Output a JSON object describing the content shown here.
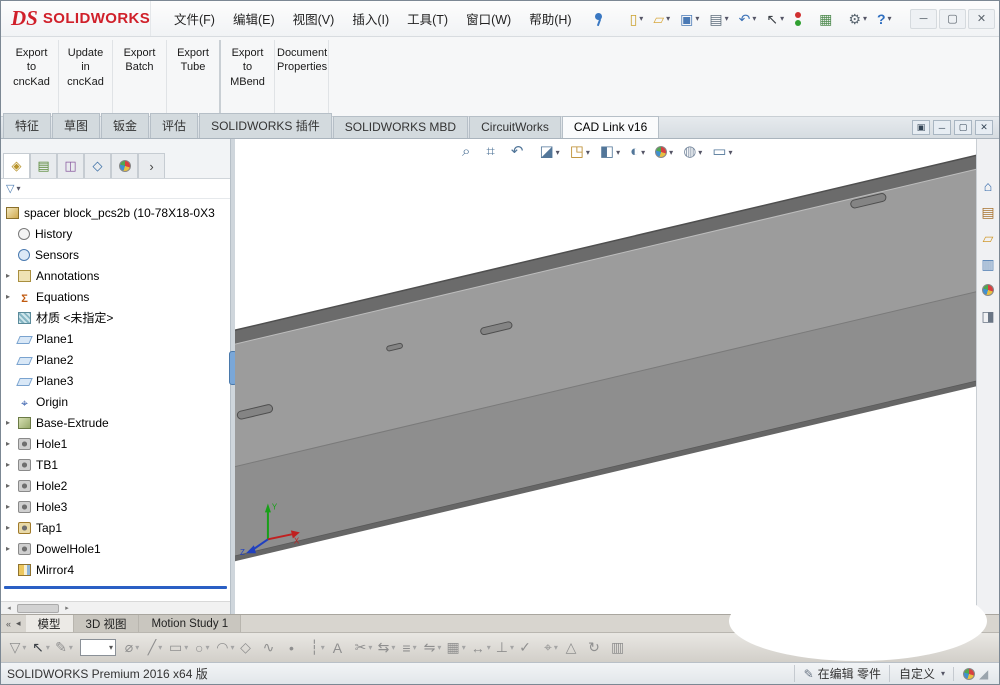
{
  "brand": {
    "ds": "DS",
    "name": "SOLIDWORKS"
  },
  "window_controls": {
    "minimize": "─",
    "maximize": "▢",
    "close": "✕"
  },
  "menu_bar": {
    "items": [
      "文件(F)",
      "编辑(E)",
      "视图(V)",
      "插入(I)",
      "工具(T)",
      "窗口(W)",
      "帮助(H)"
    ]
  },
  "quick_toolbar": {
    "buttons": [
      {
        "name": "new-document",
        "glyph": "▯",
        "caret": true
      },
      {
        "name": "open-folder",
        "glyph": "▱",
        "caret": true
      },
      {
        "name": "save",
        "glyph": "▣",
        "caret": true
      },
      {
        "name": "print",
        "glyph": "▤",
        "caret": true
      },
      {
        "name": "undo",
        "glyph": "↶",
        "caret": true
      },
      {
        "name": "select-arrow",
        "glyph": "↖",
        "caret": true
      },
      {
        "name": "xpress-products",
        "glyph": ""
      },
      {
        "name": "evaluate-sheet",
        "glyph": "▦"
      },
      {
        "name": "options-gear",
        "glyph": "⚙",
        "caret": true
      },
      {
        "name": "help",
        "glyph": "?",
        "caret": true
      }
    ]
  },
  "command_manager": {
    "buttons": [
      {
        "label": "Export\nto\ncncKad"
      },
      {
        "label": "Update\nin\ncncKad"
      },
      {
        "label": "Export\nBatch"
      },
      {
        "label": "Export\nTube"
      },
      {
        "label": "Export\nto\nMBend"
      },
      {
        "label": "Document\nProperties"
      }
    ]
  },
  "ribbon_tabs": {
    "tabs": [
      {
        "label": "特征"
      },
      {
        "label": "草图"
      },
      {
        "label": "钣金"
      },
      {
        "label": "评估"
      },
      {
        "label": "SOLIDWORKS 插件"
      },
      {
        "label": "SOLIDWORKS MBD"
      },
      {
        "label": "CircuitWorks"
      },
      {
        "label": "CAD Link v16",
        "active": true
      }
    ]
  },
  "document_controls": {
    "buttons": [
      {
        "name": "float-document",
        "glyph": "▣"
      },
      {
        "name": "minimize-document",
        "glyph": "─"
      },
      {
        "name": "restore-document",
        "glyph": "▢"
      },
      {
        "name": "close-document",
        "glyph": "✕"
      }
    ]
  },
  "feature_panel": {
    "tabs": [
      {
        "name": "featuremanager-tree-tab",
        "glyph": "◈",
        "active": true
      },
      {
        "name": "propertymanager-tab",
        "glyph": "▤"
      },
      {
        "name": "configurationmanager-tab",
        "glyph": "◫"
      },
      {
        "name": "dimxpertmanager-tab",
        "glyph": "◇"
      },
      {
        "name": "displaymanager-tab",
        "glyph": ""
      },
      {
        "name": "expand-tabs",
        "glyph": "›"
      }
    ],
    "filter_glyph": "▽",
    "root": {
      "label": "spacer block_pcs2b (10-78X18-0X3",
      "icon": "part"
    },
    "items": [
      {
        "label": "History",
        "icon": "history"
      },
      {
        "label": "Sensors",
        "icon": "sensors"
      },
      {
        "label": "Annotations",
        "icon": "annotations",
        "arrow": true
      },
      {
        "label": "Equations",
        "icon": "equations",
        "arrow": true
      },
      {
        "label": "材质 <未指定>",
        "icon": "material"
      },
      {
        "label": "Plane1",
        "icon": "plane"
      },
      {
        "label": "Plane2",
        "icon": "plane"
      },
      {
        "label": "Plane3",
        "icon": "plane"
      },
      {
        "label": "Origin",
        "icon": "origin"
      },
      {
        "label": "Base-Extrude",
        "icon": "extrude",
        "arrow": true
      },
      {
        "label": "Hole1",
        "icon": "hole",
        "arrow": true
      },
      {
        "label": "TB1",
        "icon": "hole",
        "arrow": true
      },
      {
        "label": "Hole2",
        "icon": "hole",
        "arrow": true
      },
      {
        "label": "Hole3",
        "icon": "hole",
        "arrow": true
      },
      {
        "label": "Tap1",
        "icon": "tap",
        "arrow": true
      },
      {
        "label": "DowelHole1",
        "icon": "hole",
        "arrow": true
      },
      {
        "label": "Mirror4",
        "icon": "mirror"
      }
    ]
  },
  "heads_up": {
    "buttons": [
      {
        "name": "zoom-fit",
        "glyph": "⌕"
      },
      {
        "name": "zoom-area",
        "glyph": "⌗"
      },
      {
        "name": "previous-view",
        "glyph": "↶"
      },
      {
        "name": "section-view",
        "glyph": "◪",
        "caret": true
      },
      {
        "name": "view-orientation",
        "glyph": "◳",
        "caret": true
      },
      {
        "name": "display-style",
        "glyph": "◧",
        "caret": true
      },
      {
        "name": "hide-show-items",
        "glyph": "◐",
        "caret": true
      },
      {
        "name": "edit-appearance",
        "glyph": "",
        "caret": true
      },
      {
        "name": "apply-scene",
        "glyph": "◍",
        "caret": true
      },
      {
        "name": "view-settings",
        "glyph": "▭",
        "caret": true
      }
    ]
  },
  "task_pane": {
    "buttons": [
      {
        "name": "home",
        "glyph": "⌂"
      },
      {
        "name": "design-library",
        "glyph": "▤"
      },
      {
        "name": "file-explorer",
        "glyph": "▱"
      },
      {
        "name": "view-palette",
        "glyph": "▥"
      },
      {
        "name": "appearances-scenes",
        "glyph": ""
      },
      {
        "name": "custom-properties",
        "glyph": "◨"
      }
    ]
  },
  "viewport": {
    "triad": {
      "x": "X",
      "y": "Y",
      "z": "Z"
    }
  },
  "bottom_tabs": {
    "nav": [
      {
        "name": "scroll-first",
        "glyph": "«"
      },
      {
        "name": "scroll-prev",
        "glyph": "◂"
      }
    ],
    "tabs": [
      {
        "label": "模型",
        "active": true
      },
      {
        "label": "3D 视图"
      },
      {
        "label": "Motion Study 1"
      }
    ]
  },
  "sketch_toolbar": {
    "left": [
      {
        "name": "selection-filter",
        "glyph": "▽",
        "caret": true
      },
      {
        "name": "select-arrow",
        "glyph": "↖",
        "caret": true
      },
      {
        "name": "sketch",
        "glyph": "✎",
        "caret": true
      }
    ],
    "right": [
      {
        "name": "smart-dimension",
        "glyph": "⌀",
        "caret": true
      },
      {
        "name": "line",
        "glyph": "╱",
        "caret": true
      },
      {
        "name": "corner-rectangle",
        "glyph": "▭",
        "caret": true
      },
      {
        "name": "circle",
        "glyph": "○",
        "caret": true
      },
      {
        "name": "arc",
        "glyph": "◠",
        "caret": true
      },
      {
        "name": "polygon",
        "glyph": "◇"
      },
      {
        "name": "spline",
        "glyph": "∿"
      },
      {
        "name": "point",
        "glyph": "•"
      },
      {
        "name": "centerline",
        "glyph": "┆",
        "caret": true
      },
      {
        "name": "text",
        "glyph": "A"
      },
      {
        "name": "trim-entities",
        "glyph": "✂",
        "caret": true
      },
      {
        "name": "convert-entities",
        "glyph": "⇆",
        "caret": true
      },
      {
        "name": "offset-entities",
        "glyph": "≡",
        "caret": true
      },
      {
        "name": "mirror-entities",
        "glyph": "⇋",
        "caret": true
      },
      {
        "name": "linear-sketch-pattern",
        "glyph": "▦",
        "caret": true
      },
      {
        "name": "move-entities",
        "glyph": "↔",
        "caret": true
      },
      {
        "name": "display-relations",
        "glyph": "⊥",
        "caret": true
      },
      {
        "name": "repair-sketch",
        "glyph": "✓"
      },
      {
        "name": "quick-snaps",
        "glyph": "⌖",
        "caret": true
      },
      {
        "name": "rapid-sketch",
        "glyph": "△"
      },
      {
        "name": "instant-2d",
        "glyph": "↻"
      },
      {
        "name": "sketch-picture",
        "glyph": "▥"
      }
    ]
  },
  "status_bar": {
    "product": "SOLIDWORKS Premium 2016 x64 版",
    "editing": "在编辑 零件",
    "custom": "自定义"
  }
}
